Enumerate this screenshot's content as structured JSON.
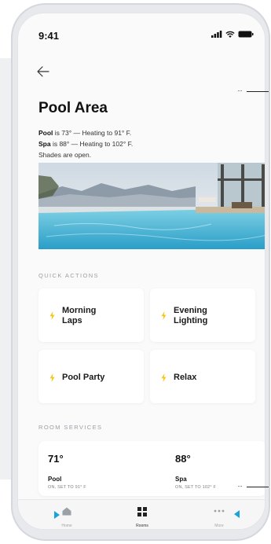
{
  "status_bar": {
    "time": "9:41"
  },
  "header": {
    "title": "Pool Area"
  },
  "status": {
    "pool_name": "Pool",
    "pool_text": " is 73° — Heating to 91° F.",
    "spa_name": "Spa",
    "spa_text": " is 88° — Heating to 102° F.",
    "shades_text": "Shades are open."
  },
  "quick_actions": {
    "label": "QUICK ACTIONS",
    "items": [
      {
        "label_line1": "Morning",
        "label_line2": "Laps"
      },
      {
        "label_line1": "Evening",
        "label_line2": "Lighting"
      },
      {
        "label": "Pool Party"
      },
      {
        "label": "Relax"
      }
    ]
  },
  "room_services": {
    "label": "ROOM SERVICES",
    "items": [
      {
        "temp": "71°",
        "name": "Pool",
        "state": "ON, SET TO 91° F"
      },
      {
        "temp": "88°",
        "name": "Spa",
        "state": "ON, SET TO 102° F"
      }
    ]
  },
  "tab_bar": {
    "tabs": [
      {
        "label": "Home",
        "icon": "home-icon"
      },
      {
        "label": "Rooms",
        "icon": "rooms-icon"
      },
      {
        "label": "More",
        "icon": "more-icon"
      }
    ]
  },
  "colors": {
    "accent": "#f5c518",
    "pointer": "#1aa3d9",
    "background": "#fafafa"
  }
}
